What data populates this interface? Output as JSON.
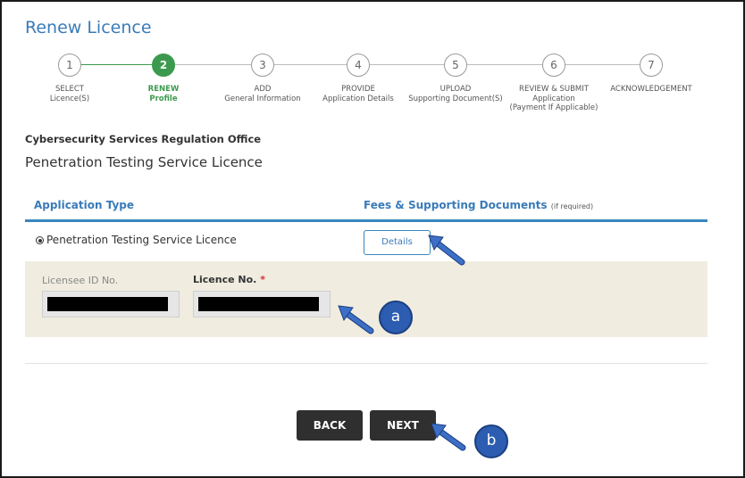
{
  "page": {
    "title": "Renew Licence"
  },
  "stepper": {
    "steps": [
      {
        "number": "1",
        "line1": "SELECT",
        "line2": "Licence(S)",
        "line3": ""
      },
      {
        "number": "2",
        "line1": "RENEW",
        "line2": "Profile",
        "line3": ""
      },
      {
        "number": "3",
        "line1": "ADD",
        "line2": "General Information",
        "line3": ""
      },
      {
        "number": "4",
        "line1": "PROVIDE",
        "line2": "Application Details",
        "line3": ""
      },
      {
        "number": "5",
        "line1": "UPLOAD",
        "line2": "Supporting Document(S)",
        "line3": ""
      },
      {
        "number": "6",
        "line1": "REVIEW & SUBMIT",
        "line2": "Application",
        "line3": "(Payment If Applicable)"
      },
      {
        "number": "7",
        "line1": "ACKNOWLEDGEMENT",
        "line2": "",
        "line3": ""
      }
    ],
    "active_step": "2"
  },
  "agency": "Cybersecurity Services Regulation Office",
  "licence_heading": "Penetration Testing Service Licence",
  "table": {
    "col_application_type": "Application Type",
    "col_fees": "Fees & Supporting Documents",
    "col_fees_note": "(if required)",
    "row_label": "Penetration Testing Service Licence",
    "details_button": "Details"
  },
  "form": {
    "licensee_id_label": "Licensee ID No.",
    "licence_no_label": "Licence No.",
    "required_mark": "*",
    "licensee_id_value": "",
    "licence_no_value": ""
  },
  "actions": {
    "back": "BACK",
    "next": "NEXT"
  },
  "callouts": {
    "a": "a",
    "b": "b"
  },
  "colors": {
    "accent_blue": "#3a7bb8",
    "step_green": "#3c9a4e",
    "panel_beige": "#f0ece0",
    "button_dark": "#2f2f2f",
    "callout_blue": "#2c5db1"
  }
}
